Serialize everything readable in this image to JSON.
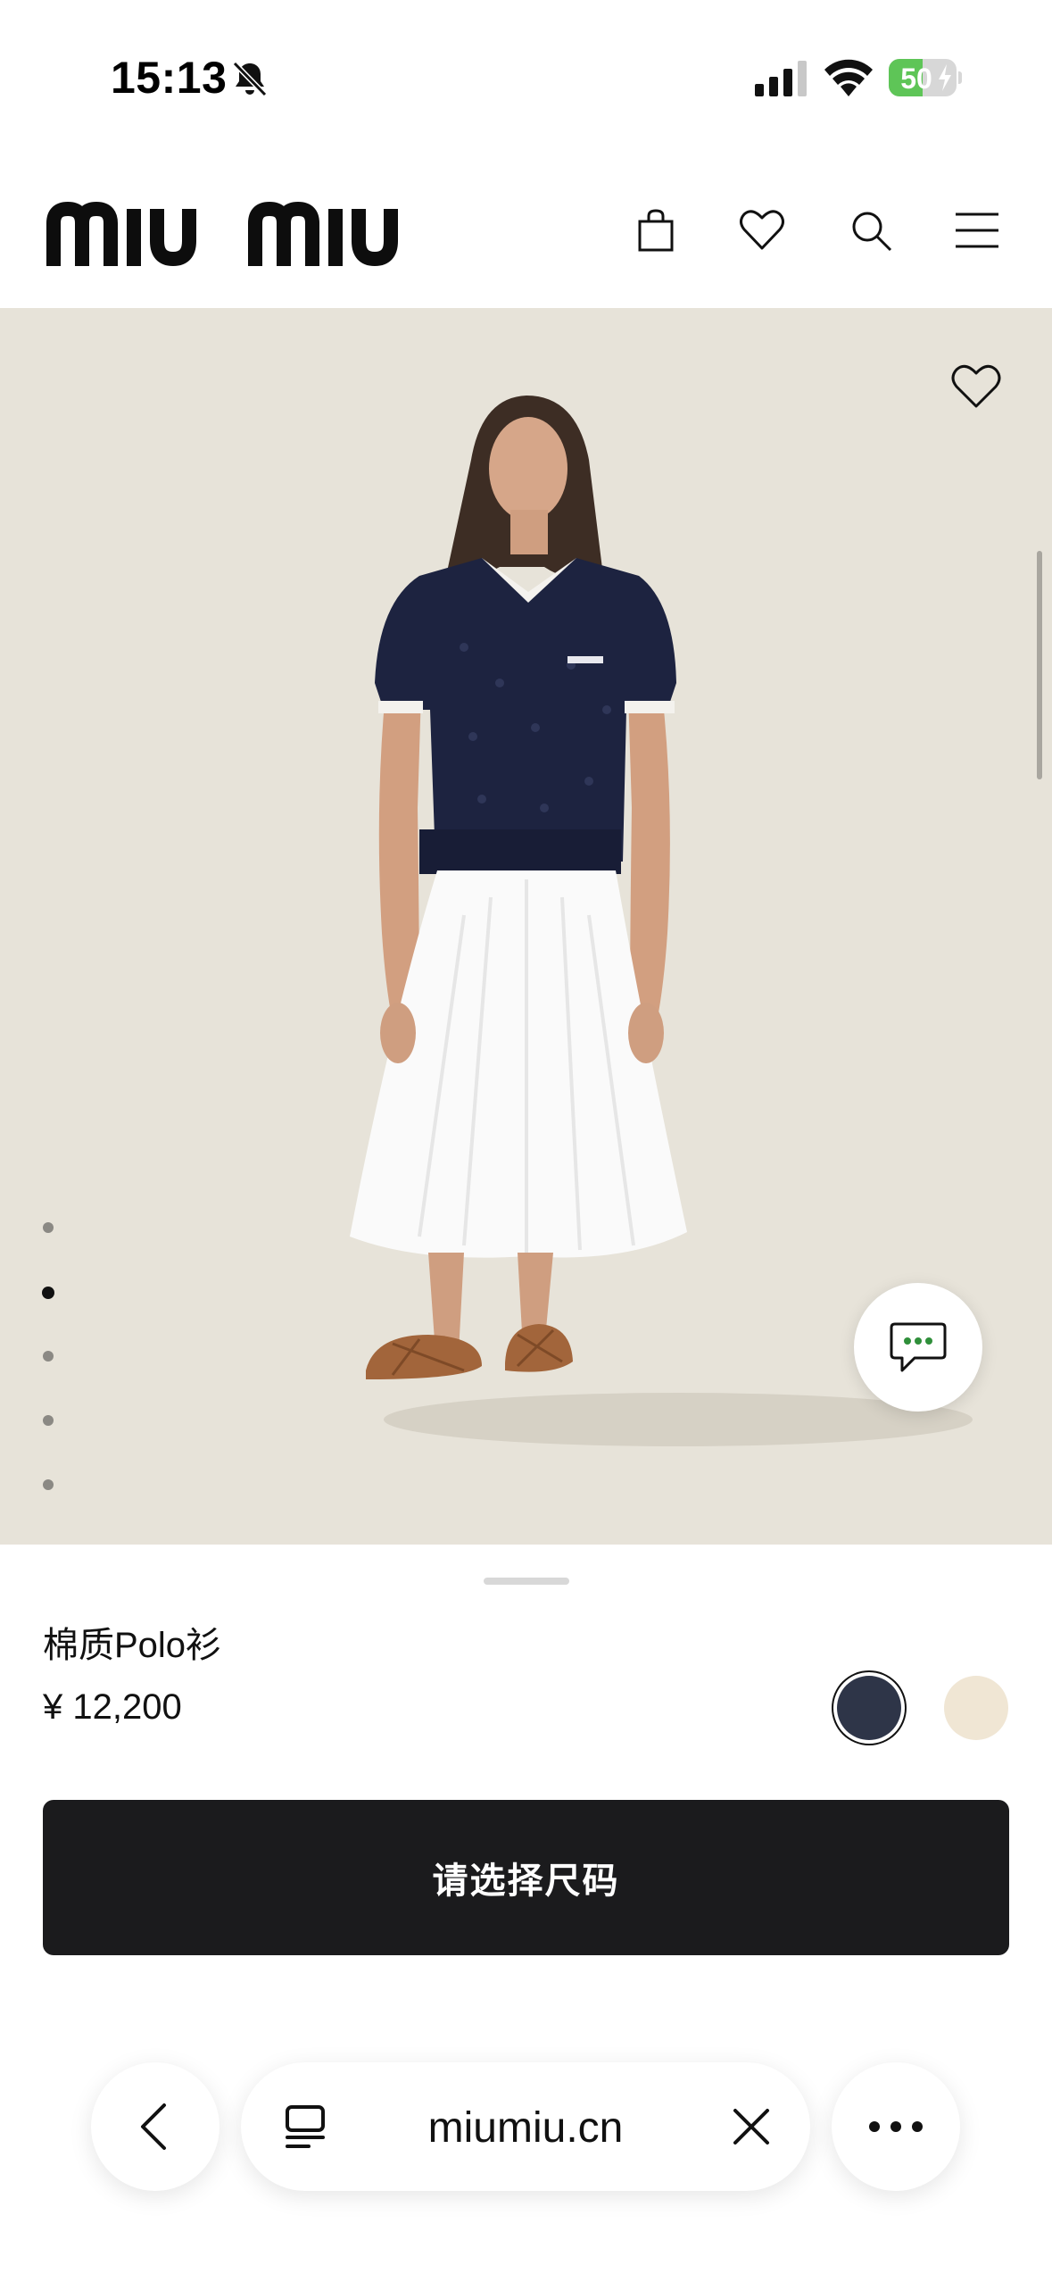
{
  "status_bar": {
    "time": "15:13",
    "battery_level": "50",
    "battery_fraction": 0.5,
    "icons": [
      "bell-slash-icon",
      "cellular-signal-icon",
      "wifi-icon",
      "battery-charging-icon"
    ]
  },
  "header": {
    "logo": "miu miu",
    "icons": [
      "shopping-bag-icon",
      "heart-icon",
      "search-icon",
      "hamburger-menu-icon"
    ]
  },
  "gallery": {
    "image_count": 5,
    "active_index": 1,
    "background_color": "#e7e3d9"
  },
  "product": {
    "name": "棉质Polo衫",
    "price": "¥ 12,200",
    "colors": [
      {
        "hex": "#2e3548",
        "selected": true
      },
      {
        "hex": "#f0e6d4",
        "selected": false
      }
    ],
    "select_size_label": "请选择尺码"
  },
  "browser": {
    "url": "miumiu.cn",
    "icons": [
      "chevron-left-icon",
      "tabs-icon",
      "close-icon",
      "more-dots-icon"
    ]
  }
}
